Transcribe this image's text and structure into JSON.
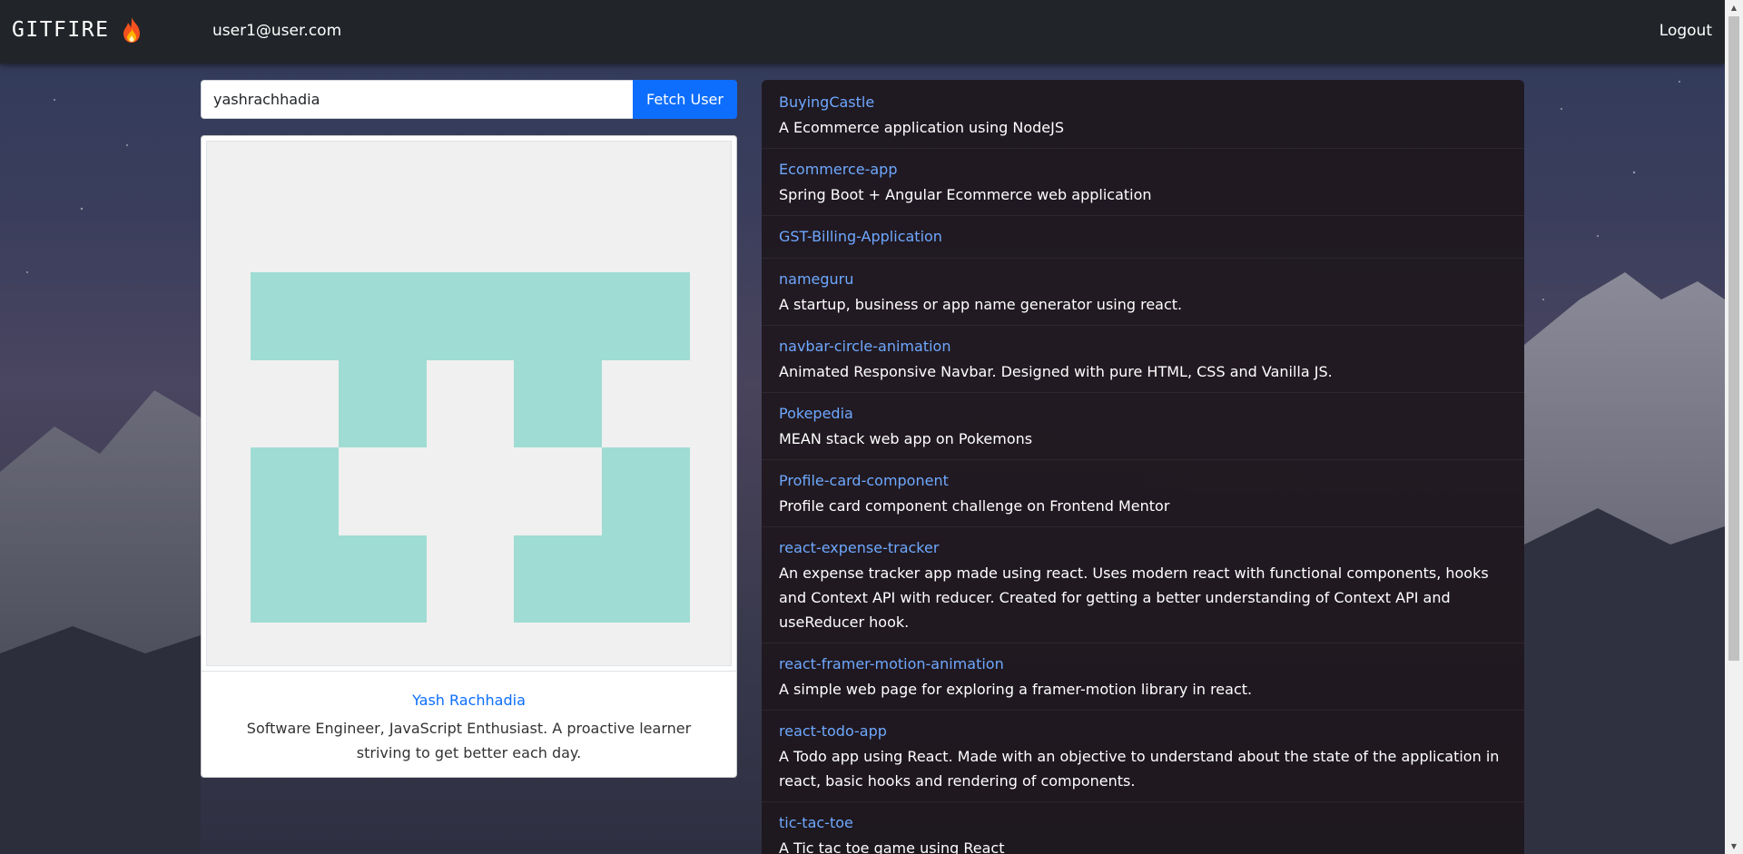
{
  "navbar": {
    "brand": "GITFIRE",
    "email": "user1@user.com",
    "logout": "Logout"
  },
  "search": {
    "value": "yashrachhadia",
    "button": "Fetch User"
  },
  "profile": {
    "name": "Yash Rachhadia",
    "bio": "Software Engineer, JavaScript Enthusiast. A proactive learner striving to get better each day."
  },
  "repos": [
    {
      "name": "BuyingCastle",
      "description": "A Ecommerce application using NodeJS"
    },
    {
      "name": "Ecommerce-app",
      "description": "Spring Boot + Angular Ecommerce web application"
    },
    {
      "name": "GST-Billing-Application",
      "description": ""
    },
    {
      "name": "nameguru",
      "description": "A startup, business or app name generator using react."
    },
    {
      "name": "navbar-circle-animation",
      "description": "Animated Responsive Navbar. Designed with pure HTML, CSS and Vanilla JS."
    },
    {
      "name": "Pokepedia",
      "description": "MEAN stack web app on Pokemons"
    },
    {
      "name": "Profile-card-component",
      "description": "Profile card component challenge on Frontend Mentor"
    },
    {
      "name": "react-expense-tracker",
      "description": "An expense tracker app made using react. Uses modern react with functional components, hooks and Context API with reducer. Created for getting a better understanding of Context API and useReducer hook."
    },
    {
      "name": "react-framer-motion-animation",
      "description": "A simple web page for exploring a framer-motion library in react."
    },
    {
      "name": "react-todo-app",
      "description": "A Todo app using React. Made with an objective to understand about the state of the application in react, basic hooks and rendering of components."
    },
    {
      "name": "tic-tac-toe",
      "description": "A Tic tac toe game using React"
    }
  ],
  "colors": {
    "navbar": "#212529",
    "accent": "#0d6efd",
    "repo_link": "#6ea8fe",
    "identicon": "#9fdcd3"
  },
  "icons": {
    "brand": "flame-icon"
  }
}
